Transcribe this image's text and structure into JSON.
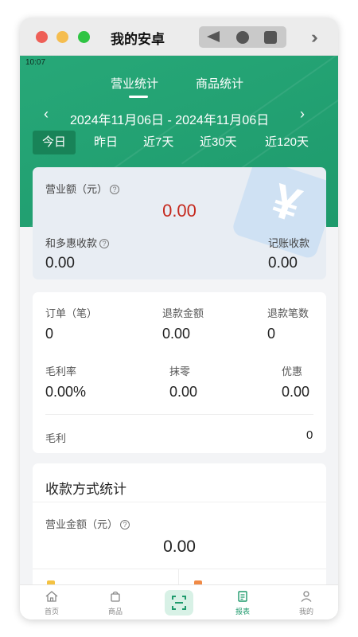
{
  "window": {
    "title": "我的安卓"
  },
  "status_bar": {
    "time": "10:07"
  },
  "tabs": [
    {
      "label": "营业统计",
      "active": true
    },
    {
      "label": "商品统计",
      "active": false
    }
  ],
  "date_range": {
    "text": "2024年11月06日 - 2024年11月06日",
    "prev": "‹",
    "next": "›"
  },
  "ranges": [
    {
      "label": "今日",
      "active": true
    },
    {
      "label": "昨日",
      "active": false
    },
    {
      "label": "近7天",
      "active": false
    },
    {
      "label": "近30天",
      "active": false
    },
    {
      "label": "近120天",
      "active": false
    }
  ],
  "summary": {
    "revenue_label": "营业额（元）",
    "revenue_value": "0.00",
    "hdh_label": "和多惠收款",
    "hdh_value": "0.00",
    "ledger_label": "记账收款",
    "ledger_value": "0.00",
    "help_glyph": "?"
  },
  "stats": {
    "orders_label": "订单（笔）",
    "orders_value": "0",
    "refund_amount_label": "退款金额",
    "refund_amount_value": "0.00",
    "refund_count_label": "退款笔数",
    "refund_count_value": "0",
    "margin_rate_label": "毛利率",
    "margin_rate_value": "0.00%",
    "rounding_label": "抹零",
    "rounding_value": "0.00",
    "discount_label": "优惠",
    "discount_value": "0.00",
    "gross_profit_label": "毛利",
    "gross_profit_value": "0"
  },
  "payment_stats": {
    "title": "收款方式统计",
    "amount_label": "营业金额（元）",
    "amount_value": "0.00",
    "help_glyph": "?"
  },
  "bottom_nav": [
    {
      "label": "首页",
      "icon": "home-icon",
      "active": false
    },
    {
      "label": "商品",
      "icon": "bag-icon",
      "active": false
    },
    {
      "label": "",
      "icon": "scan-icon",
      "active": false
    },
    {
      "label": "报表",
      "icon": "report-icon",
      "active": true
    },
    {
      "label": "我的",
      "icon": "user-icon",
      "active": false
    }
  ],
  "colors": {
    "brand_green": "#1e9a6c",
    "revenue_red": "#c5281c",
    "range_active_bg": "#188358"
  }
}
